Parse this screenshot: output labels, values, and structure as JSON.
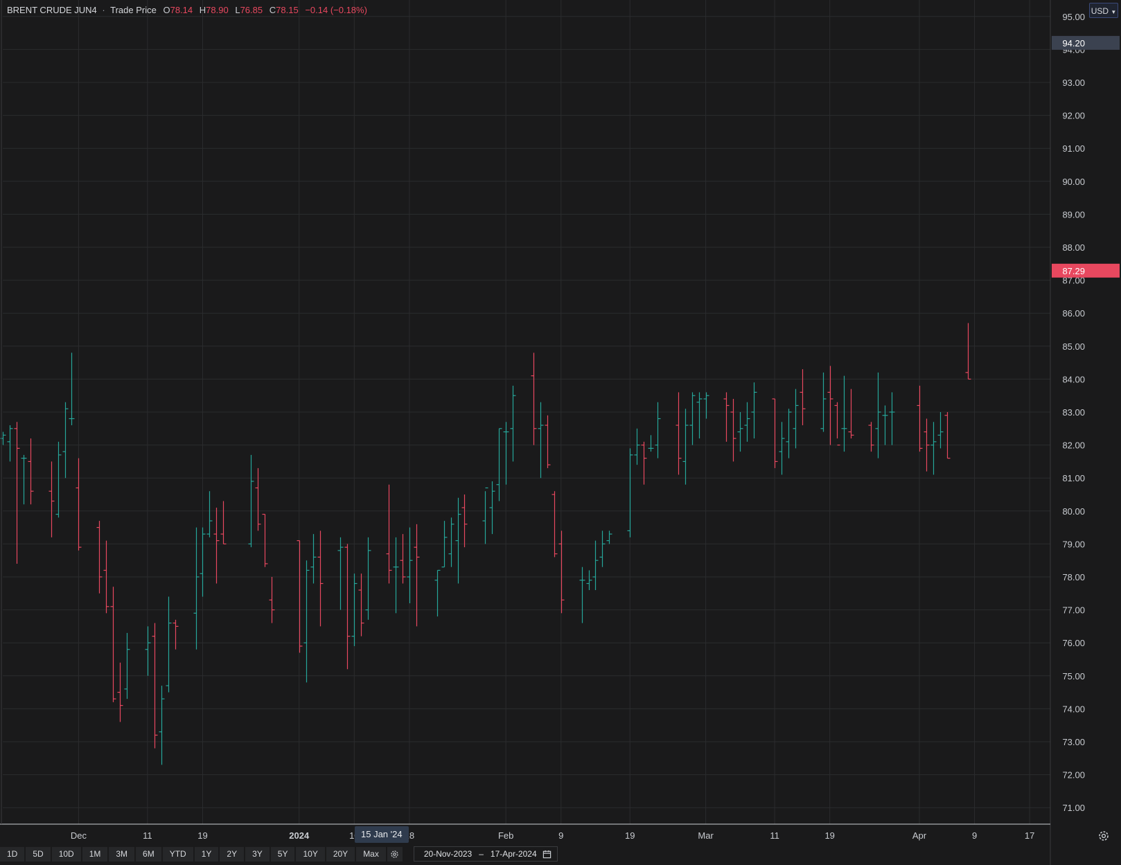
{
  "legend": {
    "symbol": "BRENT CRUDE JUN4",
    "separator": "·",
    "price_type": "Trade Price",
    "open_label": "O",
    "open": "78.14",
    "high_label": "H",
    "high": "78.90",
    "low_label": "L",
    "low": "76.85",
    "close_label": "C",
    "close": "78.15",
    "change": "−0.14 (−0.18%)"
  },
  "currency": {
    "label": "USD",
    "icon": "chevron-down-icon"
  },
  "price_tags": {
    "upper": {
      "value": "94.20",
      "price": 94.2,
      "color": "#3b4250"
    },
    "last": {
      "value": "87.29",
      "price": 87.29,
      "color": "#e8485f"
    }
  },
  "crosshair_date": "15 Jan '24",
  "range_buttons": [
    "1D",
    "5D",
    "10D",
    "1M",
    "3M",
    "6M",
    "YTD",
    "1Y",
    "2Y",
    "3Y",
    "5Y",
    "10Y",
    "20Y",
    "Max"
  ],
  "date_range": {
    "from": "20-Nov-2023",
    "to": "17-Apr-2024",
    "dash": "–"
  },
  "icons": {
    "range_settings": "gear-icon",
    "calendar": "calendar-icon",
    "axis_settings": "gear-icon"
  },
  "colors": {
    "up": "#26a69a",
    "down": "#e8485f",
    "background": "#1a1a1b",
    "grid": "#2b2c2e"
  },
  "chart_data": {
    "type": "ohlc",
    "grid": true,
    "ylim": [
      70.5,
      95.5
    ],
    "y_ticks": [
      "95.00",
      "94.00",
      "93.00",
      "92.00",
      "91.00",
      "90.00",
      "89.00",
      "88.00",
      "87.00",
      "86.00",
      "85.00",
      "84.00",
      "83.00",
      "82.00",
      "81.00",
      "80.00",
      "79.00",
      "78.00",
      "77.00",
      "76.00",
      "75.00",
      "74.00",
      "73.00",
      "72.00",
      "71.00"
    ],
    "x_ticks": [
      {
        "label": "Dec",
        "date": "2023-12-01"
      },
      {
        "label": "11",
        "date": "2023-12-11"
      },
      {
        "label": "19",
        "date": "2023-12-19"
      },
      {
        "label": "2024",
        "date": "2024-01-02",
        "bold": true
      },
      {
        "label": "10",
        "date": "2024-01-10"
      },
      {
        "label": "18",
        "date": "2024-01-18"
      },
      {
        "label": "Feb",
        "date": "2024-02-01"
      },
      {
        "label": "9",
        "date": "2024-02-09"
      },
      {
        "label": "19",
        "date": "2024-02-19"
      },
      {
        "label": "Mar",
        "date": "2024-03-01"
      },
      {
        "label": "11",
        "date": "2024-03-11"
      },
      {
        "label": "19",
        "date": "2024-03-19"
      },
      {
        "label": "Apr",
        "date": "2024-04-01"
      },
      {
        "label": "9",
        "date": "2024-04-09"
      },
      {
        "label": "17",
        "date": "2024-04-17"
      }
    ],
    "series": [
      {
        "date": "2023-11-20",
        "o": 82.2,
        "h": 82.4,
        "l": 82.0,
        "c": 82.3
      },
      {
        "date": "2023-11-21",
        "o": 82.1,
        "h": 82.6,
        "l": 81.5,
        "c": 82.5
      },
      {
        "date": "2023-11-22",
        "o": 82.5,
        "h": 82.7,
        "l": 78.4,
        "c": 81.9
      },
      {
        "date": "2023-11-23",
        "o": 81.6,
        "h": 81.7,
        "l": 80.2,
        "c": 81.6
      },
      {
        "date": "2023-11-24",
        "o": 81.5,
        "h": 82.2,
        "l": 80.2,
        "c": 80.6
      },
      {
        "date": "2023-11-27",
        "o": 80.6,
        "h": 81.5,
        "l": 79.2,
        "c": 80.3
      },
      {
        "date": "2023-11-28",
        "o": 79.9,
        "h": 82.1,
        "l": 79.8,
        "c": 81.7
      },
      {
        "date": "2023-11-29",
        "o": 81.8,
        "h": 83.3,
        "l": 81.0,
        "c": 83.1
      },
      {
        "date": "2023-11-30",
        "o": 82.8,
        "h": 84.8,
        "l": 82.6,
        "c": 82.8
      },
      {
        "date": "2023-12-01",
        "o": 80.7,
        "h": 81.6,
        "l": 78.8,
        "c": 78.9
      },
      {
        "date": "2023-12-04",
        "o": 79.5,
        "h": 79.7,
        "l": 77.5,
        "c": 78.0
      },
      {
        "date": "2023-12-05",
        "o": 78.2,
        "h": 79.1,
        "l": 76.9,
        "c": 77.1
      },
      {
        "date": "2023-12-06",
        "o": 77.1,
        "h": 77.7,
        "l": 74.2,
        "c": 74.3
      },
      {
        "date": "2023-12-07",
        "o": 74.5,
        "h": 75.4,
        "l": 73.6,
        "c": 74.1
      },
      {
        "date": "2023-12-08",
        "o": 74.6,
        "h": 76.3,
        "l": 74.3,
        "c": 75.8
      },
      {
        "date": "2023-12-11",
        "o": 75.8,
        "h": 76.5,
        "l": 75.0,
        "c": 76.0
      },
      {
        "date": "2023-12-12",
        "o": 76.2,
        "h": 76.6,
        "l": 72.8,
        "c": 73.2
      },
      {
        "date": "2023-12-13",
        "o": 73.3,
        "h": 74.7,
        "l": 72.3,
        "c": 74.3
      },
      {
        "date": "2023-12-14",
        "o": 74.7,
        "h": 77.4,
        "l": 74.5,
        "c": 76.6
      },
      {
        "date": "2023-12-15",
        "o": 76.6,
        "h": 76.7,
        "l": 75.8,
        "c": 76.5
      },
      {
        "date": "2023-12-18",
        "o": 76.9,
        "h": 79.5,
        "l": 75.8,
        "c": 78.0
      },
      {
        "date": "2023-12-19",
        "o": 78.1,
        "h": 79.5,
        "l": 77.4,
        "c": 79.3
      },
      {
        "date": "2023-12-20",
        "o": 79.3,
        "h": 80.6,
        "l": 79.2,
        "c": 79.7
      },
      {
        "date": "2023-12-21",
        "o": 79.3,
        "h": 80.1,
        "l": 77.8,
        "c": 79.1
      },
      {
        "date": "2023-12-22",
        "o": 79.3,
        "h": 80.3,
        "l": 79.0,
        "c": 79.0
      },
      {
        "date": "2023-12-26",
        "o": 79.0,
        "h": 81.7,
        "l": 78.9,
        "c": 80.9
      },
      {
        "date": "2023-12-27",
        "o": 80.7,
        "h": 81.3,
        "l": 79.4,
        "c": 79.6
      },
      {
        "date": "2023-12-28",
        "o": 79.9,
        "h": 79.9,
        "l": 78.3,
        "c": 78.4
      },
      {
        "date": "2023-12-29",
        "o": 77.3,
        "h": 78.0,
        "l": 76.6,
        "c": 77.0
      },
      {
        "date": "2024-01-02",
        "o": 79.1,
        "h": 79.1,
        "l": 75.7,
        "c": 75.9
      },
      {
        "date": "2024-01-03",
        "o": 76.0,
        "h": 78.5,
        "l": 74.8,
        "c": 78.2
      },
      {
        "date": "2024-01-04",
        "o": 78.3,
        "h": 79.3,
        "l": 77.8,
        "c": 78.6
      },
      {
        "date": "2024-01-05",
        "o": 78.6,
        "h": 79.4,
        "l": 76.5,
        "c": 77.8
      },
      {
        "date": "2024-01-08",
        "o": 78.8,
        "h": 79.2,
        "l": 77.0,
        "c": 78.9
      },
      {
        "date": "2024-01-09",
        "o": 78.9,
        "h": 79.0,
        "l": 75.2,
        "c": 76.2
      },
      {
        "date": "2024-01-10",
        "o": 76.2,
        "h": 78.1,
        "l": 75.9,
        "c": 77.8
      },
      {
        "date": "2024-01-11",
        "o": 77.6,
        "h": 78.1,
        "l": 76.2,
        "c": 76.6
      },
      {
        "date": "2024-01-12",
        "o": 77.0,
        "h": 79.2,
        "l": 76.7,
        "c": 78.8
      },
      {
        "date": "2024-01-15",
        "o": 78.7,
        "h": 80.8,
        "l": 77.8,
        "c": 78.2
      },
      {
        "date": "2024-01-16",
        "o": 78.3,
        "h": 79.2,
        "l": 76.9,
        "c": 78.3
      },
      {
        "date": "2024-01-17",
        "o": 78.5,
        "h": 79.3,
        "l": 77.8,
        "c": 78.0
      },
      {
        "date": "2024-01-18",
        "o": 78.0,
        "h": 79.5,
        "l": 77.2,
        "c": 78.5
      },
      {
        "date": "2024-01-19",
        "o": 78.9,
        "h": 79.6,
        "l": 76.5,
        "c": 78.6
      },
      {
        "date": "2024-01-22",
        "o": 77.9,
        "h": 78.2,
        "l": 76.8,
        "c": 78.2
      },
      {
        "date": "2024-01-23",
        "o": 78.3,
        "h": 79.7,
        "l": 78.3,
        "c": 79.2
      },
      {
        "date": "2024-01-24",
        "o": 78.7,
        "h": 79.8,
        "l": 78.3,
        "c": 79.6
      },
      {
        "date": "2024-01-25",
        "o": 79.1,
        "h": 80.4,
        "l": 77.8,
        "c": 79.9
      },
      {
        "date": "2024-01-26",
        "o": 80.1,
        "h": 80.5,
        "l": 78.9,
        "c": 79.6
      },
      {
        "date": "2024-01-29",
        "o": 79.7,
        "h": 80.6,
        "l": 79.0,
        "c": 80.7
      },
      {
        "date": "2024-01-30",
        "o": 80.1,
        "h": 80.9,
        "l": 79.3,
        "c": 80.6
      },
      {
        "date": "2024-01-31",
        "o": 80.8,
        "h": 82.5,
        "l": 80.3,
        "c": 82.5
      },
      {
        "date": "2024-02-01",
        "o": 82.4,
        "h": 82.7,
        "l": 80.8,
        "c": 82.4
      },
      {
        "date": "2024-02-02",
        "o": 82.5,
        "h": 83.8,
        "l": 81.5,
        "c": 83.5
      },
      {
        "date": "2024-02-05",
        "o": 84.1,
        "h": 84.8,
        "l": 82.0,
        "c": 82.5
      },
      {
        "date": "2024-02-06",
        "o": 82.5,
        "h": 83.3,
        "l": 81.0,
        "c": 82.6
      },
      {
        "date": "2024-02-07",
        "o": 82.6,
        "h": 82.9,
        "l": 81.3,
        "c": 81.4
      },
      {
        "date": "2024-02-08",
        "o": 80.5,
        "h": 80.6,
        "l": 78.6,
        "c": 78.7
      },
      {
        "date": "2024-02-09",
        "o": 79.0,
        "h": 79.4,
        "l": 76.9,
        "c": 77.3
      },
      {
        "date": "2024-02-12",
        "o": 77.9,
        "h": 78.3,
        "l": 76.6,
        "c": 77.9
      },
      {
        "date": "2024-02-13",
        "o": 77.8,
        "h": 78.2,
        "l": 77.6,
        "c": 77.9
      },
      {
        "date": "2024-02-14",
        "o": 78.0,
        "h": 79.1,
        "l": 77.6,
        "c": 78.5
      },
      {
        "date": "2024-02-15",
        "o": 78.6,
        "h": 79.4,
        "l": 78.3,
        "c": 79.0
      },
      {
        "date": "2024-02-16",
        "o": 79.1,
        "h": 79.4,
        "l": 79.0,
        "c": 79.3
      },
      {
        "date": "2024-02-19",
        "o": 79.4,
        "h": 81.9,
        "l": 79.2,
        "c": 81.7
      },
      {
        "date": "2024-02-20",
        "o": 81.7,
        "h": 82.5,
        "l": 81.4,
        "c": 82.0
      },
      {
        "date": "2024-02-21",
        "o": 82.0,
        "h": 82.1,
        "l": 80.8,
        "c": 81.6
      },
      {
        "date": "2024-02-22",
        "o": 81.9,
        "h": 82.3,
        "l": 81.8,
        "c": 81.9
      },
      {
        "date": "2024-02-23",
        "o": 82.0,
        "h": 83.3,
        "l": 81.6,
        "c": 82.8
      },
      {
        "date": "2024-02-26",
        "o": 82.6,
        "h": 83.6,
        "l": 81.1,
        "c": 81.6
      },
      {
        "date": "2024-02-27",
        "o": 81.5,
        "h": 83.1,
        "l": 80.8,
        "c": 82.6
      },
      {
        "date": "2024-02-28",
        "o": 82.6,
        "h": 83.6,
        "l": 82.0,
        "c": 83.5
      },
      {
        "date": "2024-02-29",
        "o": 83.3,
        "h": 83.6,
        "l": 82.2,
        "c": 83.4
      },
      {
        "date": "2024-03-01",
        "o": 83.4,
        "h": 83.6,
        "l": 82.8,
        "c": 83.5
      },
      {
        "date": "2024-03-04",
        "o": 83.4,
        "h": 83.6,
        "l": 82.1,
        "c": 83.2
      },
      {
        "date": "2024-03-05",
        "o": 83.0,
        "h": 83.4,
        "l": 81.5,
        "c": 82.2
      },
      {
        "date": "2024-03-06",
        "o": 82.4,
        "h": 83.0,
        "l": 81.8,
        "c": 82.5
      },
      {
        "date": "2024-03-07",
        "o": 82.6,
        "h": 83.3,
        "l": 82.1,
        "c": 82.8
      },
      {
        "date": "2024-03-08",
        "o": 83.0,
        "h": 83.9,
        "l": 82.2,
        "c": 83.6
      },
      {
        "date": "2024-03-11",
        "o": 83.4,
        "h": 83.4,
        "l": 81.3,
        "c": 81.5
      },
      {
        "date": "2024-03-12",
        "o": 81.8,
        "h": 82.7,
        "l": 81.1,
        "c": 82.2
      },
      {
        "date": "2024-03-13",
        "o": 82.1,
        "h": 83.1,
        "l": 81.6,
        "c": 83.0
      },
      {
        "date": "2024-03-14",
        "o": 82.5,
        "h": 83.7,
        "l": 81.9,
        "c": 83.2
      },
      {
        "date": "2024-03-15",
        "o": 83.6,
        "h": 84.3,
        "l": 82.6,
        "c": 83.1
      },
      {
        "date": "2024-03-18",
        "o": 82.5,
        "h": 84.2,
        "l": 82.4,
        "c": 83.4
      },
      {
        "date": "2024-03-19",
        "o": 83.6,
        "h": 84.4,
        "l": 82.0,
        "c": 83.4
      },
      {
        "date": "2024-03-20",
        "o": 83.2,
        "h": 83.3,
        "l": 82.2,
        "c": 82.0
      },
      {
        "date": "2024-03-21",
        "o": 82.5,
        "h": 84.1,
        "l": 81.8,
        "c": 82.5
      },
      {
        "date": "2024-03-22",
        "o": 82.4,
        "h": 83.7,
        "l": 82.2,
        "c": 82.3
      },
      {
        "date": "2024-03-25",
        "o": 82.6,
        "h": 82.7,
        "l": 81.8,
        "c": 82.0
      },
      {
        "date": "2024-03-26",
        "o": 82.5,
        "h": 84.2,
        "l": 81.6,
        "c": 83.0
      },
      {
        "date": "2024-03-27",
        "o": 82.9,
        "h": 83.2,
        "l": 82.0,
        "c": 82.9
      },
      {
        "date": "2024-03-28",
        "o": 83.0,
        "h": 83.6,
        "l": 82.0,
        "c": 83.0
      },
      {
        "date": "2024-04-01",
        "o": 83.2,
        "h": 83.8,
        "l": 81.8,
        "c": 81.9
      },
      {
        "date": "2024-04-02",
        "o": 82.4,
        "h": 82.8,
        "l": 81.2,
        "c": 82.0
      },
      {
        "date": "2024-04-03",
        "o": 82.0,
        "h": 82.7,
        "l": 81.1,
        "c": 82.1
      },
      {
        "date": "2024-04-04",
        "o": 82.3,
        "h": 83.0,
        "l": 81.9,
        "c": 82.4
      },
      {
        "date": "2024-04-05",
        "o": 82.9,
        "h": 83.0,
        "l": 81.6,
        "c": 81.6
      },
      {
        "date": "2024-04-08",
        "o": 84.2,
        "h": 85.7,
        "l": 84.0,
        "c": 84.0
      }
    ]
  }
}
